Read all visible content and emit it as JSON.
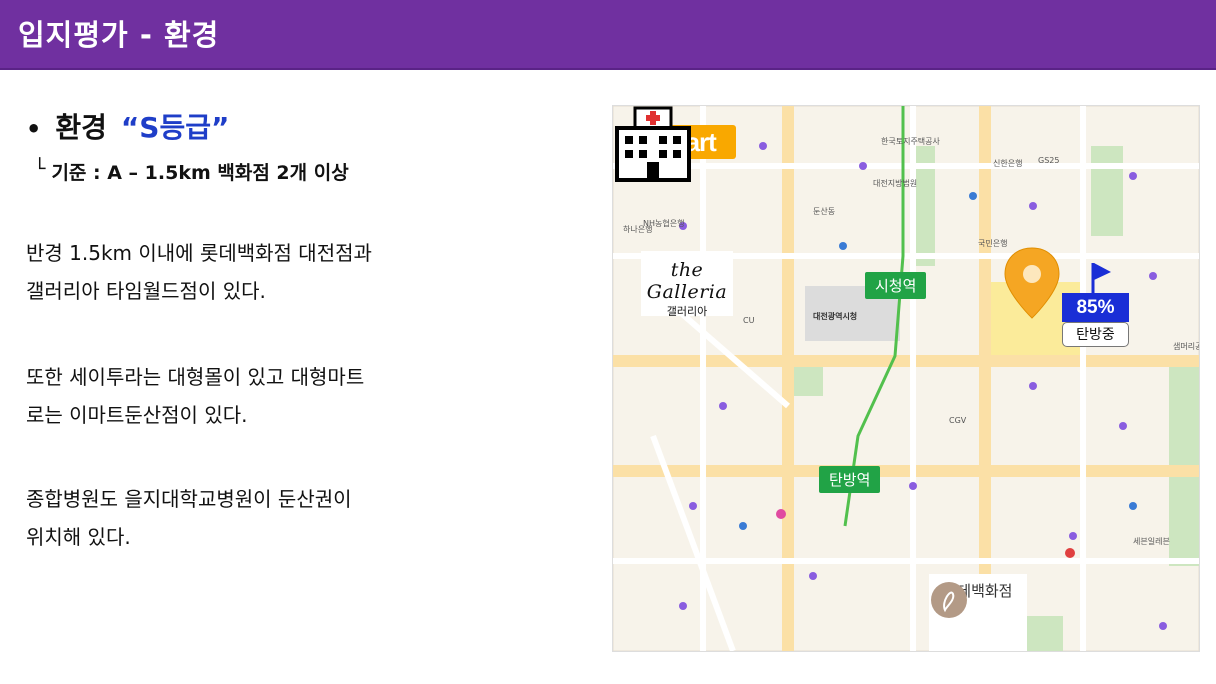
{
  "header": {
    "title": "입지평가 - 환경"
  },
  "bullet": {
    "label": "환경",
    "grade": "“S등급”"
  },
  "criteria": {
    "mark": "└",
    "text": "기준 : A – 1.5km 백화점 2개 이상"
  },
  "paragraphs": [
    [
      "반경 1.5km 이내에 롯데백화점 대전점과",
      "갤러리아 타임월드점이 있다."
    ],
    [
      "또한 세이투라는 대형몰이 있고 대형마트",
      "로는 이마트둔산점이 있다."
    ],
    [
      "종합병원도 을지대학교병원이 둔산권이",
      "위치해 있다."
    ]
  ],
  "map": {
    "emart_logo": "emart",
    "galleria_logo": "the Galleria",
    "galleria_sub": "갤러리아",
    "lotte_text": "롯데백화점",
    "stations": {
      "city_hall": "시청역",
      "tanbang": "탄방역"
    },
    "target": {
      "percent": "85%",
      "status": "탄방중"
    },
    "colors": {
      "station_green": "#21a346",
      "badge_blue": "#1a2ed6",
      "pin_orange": "#f5a623",
      "highlight_yellow": "#fbe98c"
    },
    "poi_labels": [
      "대전광역시청",
      "둔산동",
      "샘머리공원",
      "신한은행",
      "국민은행",
      "하나은행",
      "NH농협은행",
      "CGV",
      "GS25",
      "CU",
      "세븐일레븐",
      "대전지방법원",
      "한국토지주택공사"
    ]
  }
}
